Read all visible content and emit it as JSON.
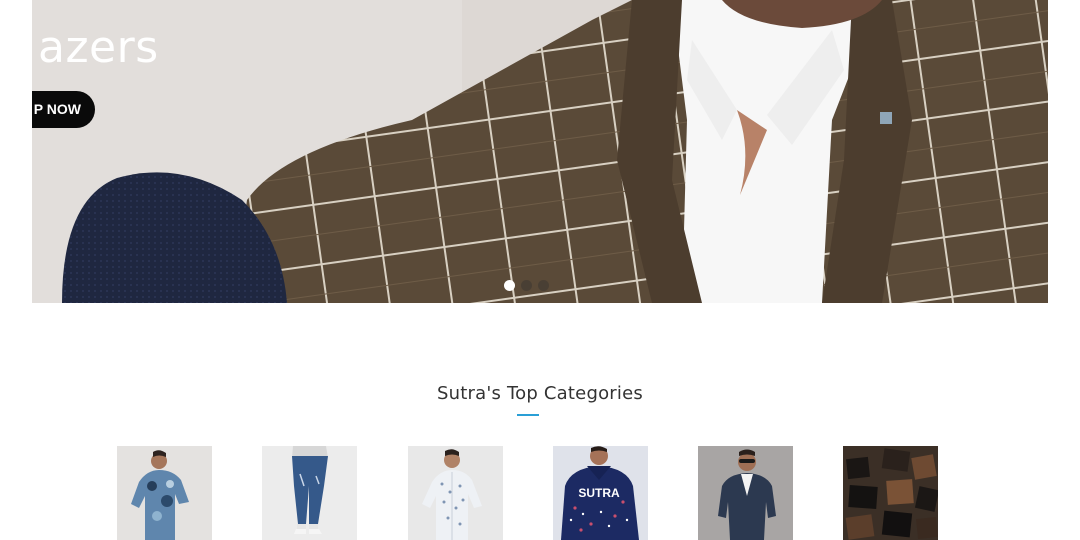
{
  "hero": {
    "title": "azers",
    "button_label": "P NOW",
    "slides": [
      {
        "active": true
      },
      {
        "active": false
      },
      {
        "active": false
      }
    ]
  },
  "categories": {
    "heading": "Sutra's Top Categories",
    "accent_color": "#2a9fd6",
    "tiles": [
      {
        "name": "printed-tshirt"
      },
      {
        "name": "jeans"
      },
      {
        "name": "printed-shirt"
      },
      {
        "name": "sweatshirt",
        "print_text": "SUTRA"
      },
      {
        "name": "blazer"
      },
      {
        "name": "wallets"
      }
    ]
  }
}
